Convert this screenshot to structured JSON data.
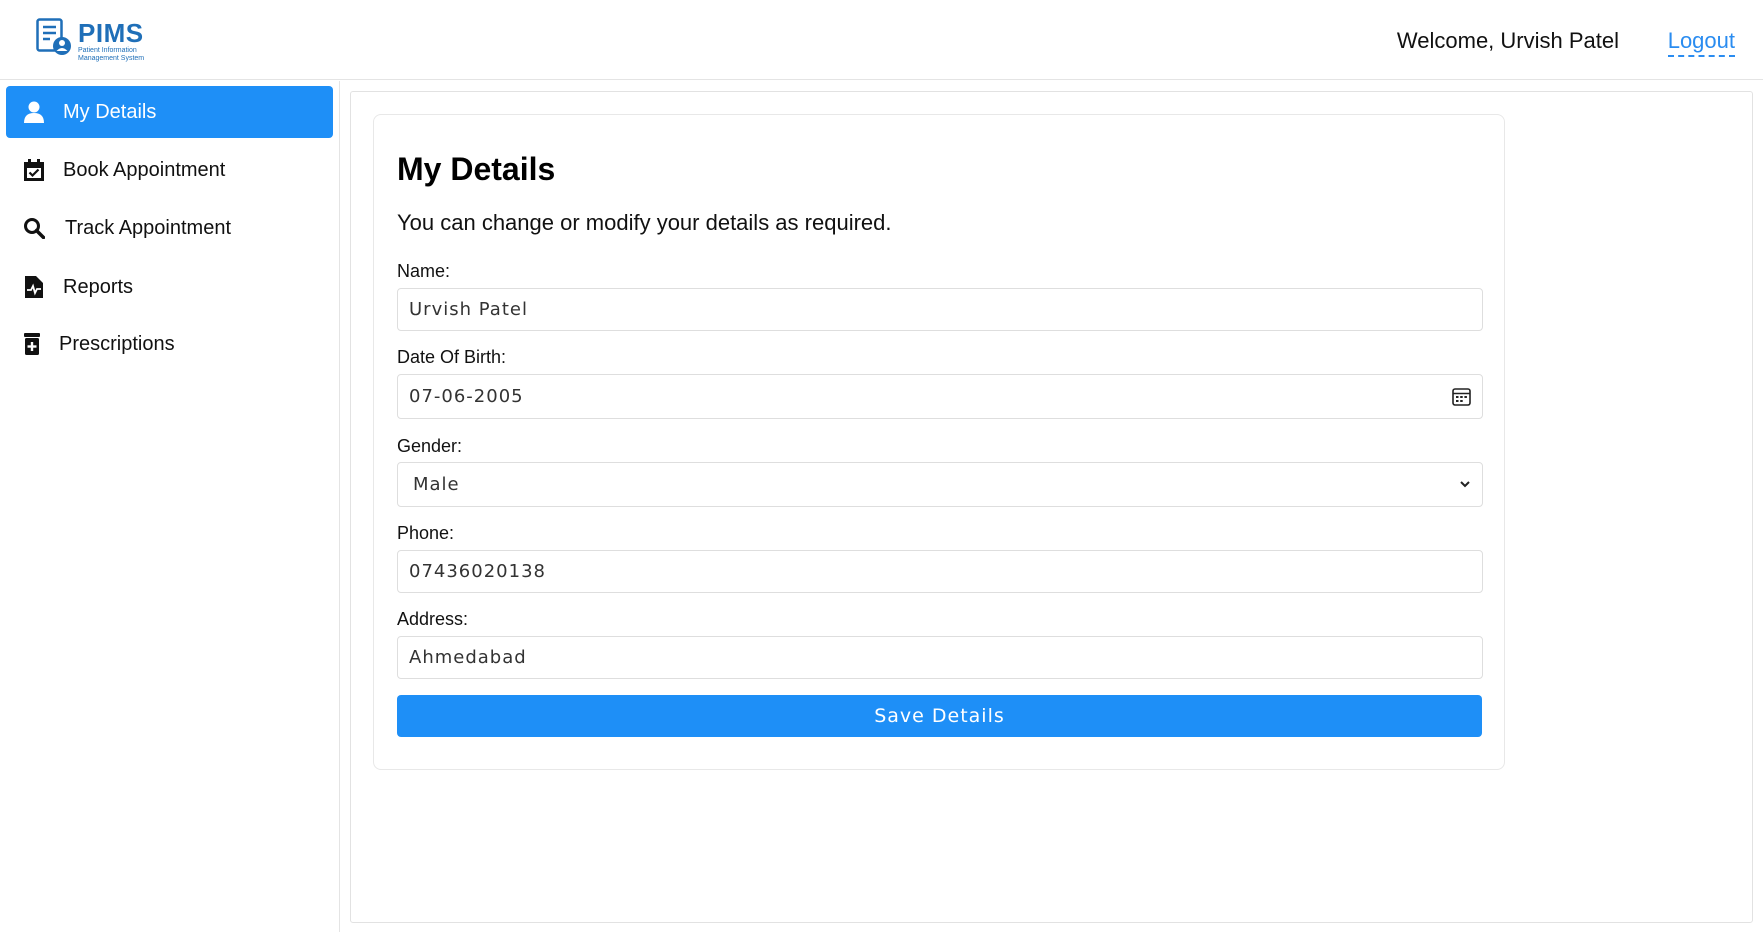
{
  "header": {
    "logo_text": "PIMS",
    "logo_subtitle": "Patient Information Management System",
    "welcome_text": "Welcome, Urvish Patel",
    "logout_label": "Logout"
  },
  "sidebar": {
    "items": [
      {
        "label": "My Details",
        "icon": "user-icon",
        "active": true
      },
      {
        "label": "Book Appointment",
        "icon": "calendar-check-icon",
        "active": false
      },
      {
        "label": "Track Appointment",
        "icon": "search-icon",
        "active": false
      },
      {
        "label": "Reports",
        "icon": "medical-file-icon",
        "active": false
      },
      {
        "label": "Prescriptions",
        "icon": "prescription-bottle-icon",
        "active": false
      }
    ]
  },
  "main": {
    "title": "My Details",
    "subtitle": "You can change or modify your details as required.",
    "fields": {
      "name": {
        "label": "Name:",
        "value": "Urvish Patel"
      },
      "dob": {
        "label": "Date Of Birth:",
        "value": "07-06-2005"
      },
      "gender": {
        "label": "Gender:",
        "value": "Male"
      },
      "phone": {
        "label": "Phone:",
        "value": "07436020138"
      },
      "address": {
        "label": "Address:",
        "value": "Ahmedabad"
      }
    },
    "save_label": "Save Details"
  },
  "colors": {
    "accent": "#1e8ff7",
    "logo": "#1f6fb8",
    "link": "#2a8cf0"
  }
}
